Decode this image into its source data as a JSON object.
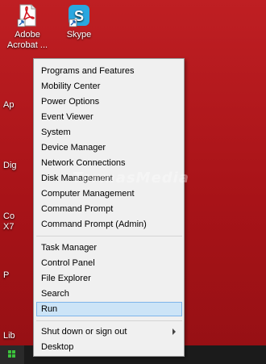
{
  "desktop": {
    "icons": [
      {
        "name": "adobe-acrobat-icon",
        "label_line1": "Adobe",
        "label_line2": "Acrobat ..."
      },
      {
        "name": "skype-icon",
        "label_line1": "Skype",
        "label_line2": ""
      }
    ],
    "side_labels": [
      "Ap",
      "Dig",
      "Co",
      "X7",
      "P",
      "Lib"
    ],
    "watermark": "TermasMedia"
  },
  "menu": {
    "items": [
      "Programs and Features",
      "Mobility Center",
      "Power Options",
      "Event Viewer",
      "System",
      "Device Manager",
      "Network Connections",
      "Disk Management",
      "Computer Management",
      "Command Prompt",
      "Command Prompt (Admin)",
      "Task Manager",
      "Control Panel",
      "File Explorer",
      "Search",
      "Run",
      "Shut down or sign out",
      "Desktop"
    ],
    "selected": "Run"
  },
  "colors": {
    "desktop_background": "#b3171c",
    "menu_background": "#f0f0f0",
    "selection_fill": "#cce4f7",
    "selection_border": "#7eb4ea"
  }
}
